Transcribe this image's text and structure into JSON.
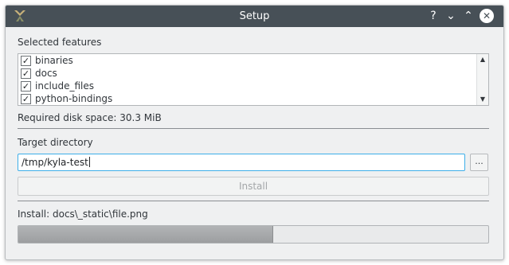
{
  "window": {
    "title": "Setup",
    "help_glyph": "?",
    "min_glyph": "⌄",
    "max_glyph": "⌃",
    "close_glyph": "✕"
  },
  "features": {
    "heading": "Selected features",
    "items": [
      {
        "label": "binaries",
        "checked": true
      },
      {
        "label": "docs",
        "checked": true
      },
      {
        "label": "include_files",
        "checked": true
      },
      {
        "label": "python-bindings",
        "checked": true
      }
    ],
    "check_glyph": "✓"
  },
  "disk_space": "Required disk space: 30.3 MiB",
  "target": {
    "heading": "Target directory",
    "value": "/tmp/kyla-test",
    "browse_label": "..."
  },
  "install_button": "Install",
  "status": "Install: docs\\_static\\file.png",
  "progress": {
    "fraction": 0.54
  },
  "colors": {
    "titlebar": "#475057",
    "accent": "#3daee9",
    "window_bg": "#eff0f1"
  }
}
